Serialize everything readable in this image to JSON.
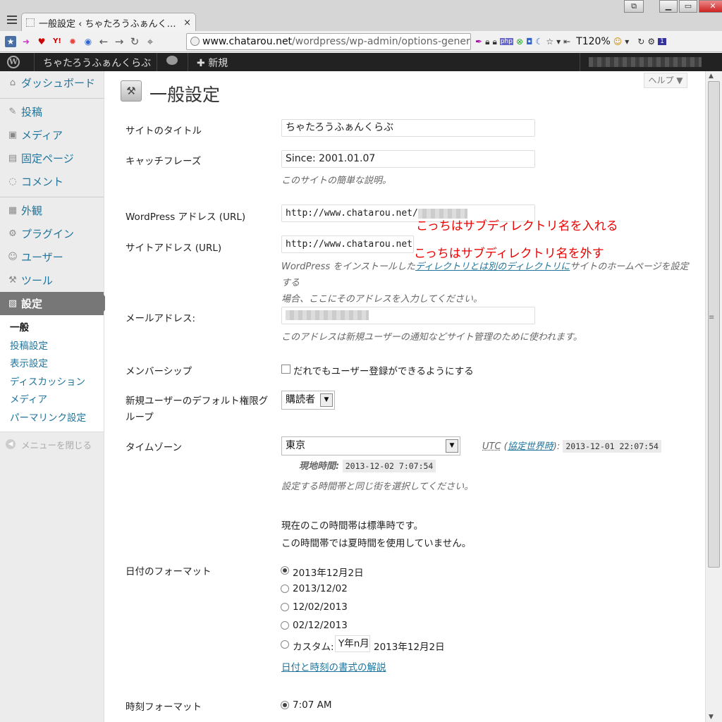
{
  "browser": {
    "tab_title": "一般設定 ‹ ちゃたろうふぁんく…",
    "tab_close": "×",
    "url_host": "www.chatarou.net",
    "url_path": "/wordpress/wp-admin/options-general.pl",
    "zoom": "T120%",
    "window_buttons": {
      "extra": "⧉",
      "minimize": "▁",
      "maximize": "▭",
      "close": "✕"
    }
  },
  "adminbar": {
    "site_name": "ちゃたろうふぁんくらぶ",
    "new_label": "新規",
    "new_plus": "✚"
  },
  "sidebar": {
    "items": [
      {
        "label": "ダッシュボード",
        "icon": "⌂"
      },
      {
        "label": "投稿",
        "icon": "✎"
      },
      {
        "label": "メディア",
        "icon": "▣"
      },
      {
        "label": "固定ページ",
        "icon": "▤"
      },
      {
        "label": "コメント",
        "icon": "◌"
      },
      {
        "label": "外観",
        "icon": "▦"
      },
      {
        "label": "プラグイン",
        "icon": "⚙"
      },
      {
        "label": "ユーザー",
        "icon": "☺"
      },
      {
        "label": "ツール",
        "icon": "⚒"
      },
      {
        "label": "設定",
        "icon": "▧"
      }
    ],
    "submenu": [
      "一般",
      "投稿設定",
      "表示設定",
      "ディスカッション",
      "メディア",
      "パーマリンク設定"
    ],
    "collapse_label": "メニューを閉じる",
    "collapse_icon": "◀"
  },
  "page": {
    "help_label": "ヘルプ ▼",
    "title": "一般設定",
    "title_icon": "⚒"
  },
  "form": {
    "site_title": {
      "label": "サイトのタイトル",
      "value": "ちゃたろうふぁんくらぶ"
    },
    "tagline": {
      "label": "キャッチフレーズ",
      "value": "Since: 2001.01.07",
      "description": "このサイトの簡単な説明。"
    },
    "wp_address": {
      "label": "WordPress アドレス (URL)",
      "value": "http://www.chatarou.net/"
    },
    "site_address": {
      "label": "サイトアドレス (URL)",
      "value": "http://www.chatarou.net",
      "description_pre": "WordPress をインストールした",
      "description_link": "ディレクトリとは別のディレクトリに",
      "description_post": "サイトのホームページを設定する",
      "description_line2": "場合、ここにそのアドレスを入力してください。"
    },
    "email": {
      "label": "メールアドレス:",
      "description": "このアドレスは新規ユーザーの通知などサイト管理のために使われます。"
    },
    "membership": {
      "label": "メンバーシップ",
      "checkbox_label": "だれでもユーザー登録ができるようにする"
    },
    "default_role": {
      "label_line1": "新規ユーザーのデフォルト権限グ",
      "label_line2": "ループ",
      "value": "購読者"
    },
    "timezone": {
      "label": "タイムゾーン",
      "value": "東京",
      "utc_label": "UTC",
      "utc_open": " (",
      "utc_link": "協定世界時",
      "utc_close": "):",
      "utc_time": "2013-12-01 22:07:54",
      "local_label": "現地時間:",
      "local_time": "2013-12-02 7:07:54",
      "description": "設定する時間帯と同じ街を選択してください。",
      "standard_time": "現在のこの時間帯は標準時です。",
      "dst": "この時間帯では夏時間を使用していません。"
    },
    "date_format": {
      "label": "日付のフォーマット",
      "options": [
        "2013年12月2日",
        "2013/12/02",
        "12/02/2013",
        "02/12/2013"
      ],
      "selected_index": 0,
      "custom_label": "カスタム:",
      "custom_value": "Y年n月",
      "custom_preview": "2013年12月2日",
      "doc_link": "日付と時刻の書式の解説"
    },
    "time_format": {
      "label": "時刻フォーマット",
      "first_option": "7:07 AM"
    }
  },
  "annotations": {
    "wp_address_note": "こっちはサブディレクトリ名を入れる",
    "site_address_note": "こっちはサブディレクトリ名を外す"
  },
  "icons": {
    "menu": "hamburger-icon",
    "back": "←",
    "forward": "→",
    "reload": "↻",
    "home": "⌖",
    "bookmark_star": "☆",
    "dropdown": "▾",
    "select_arrow": "▼",
    "scroll_up": "▲",
    "scroll_down": "▼",
    "scroll_grip": "≡"
  },
  "colors": {
    "admin_bar": "#222222",
    "link": "#21759b",
    "annotation": "#ee0000",
    "current_menu": "#777777"
  }
}
